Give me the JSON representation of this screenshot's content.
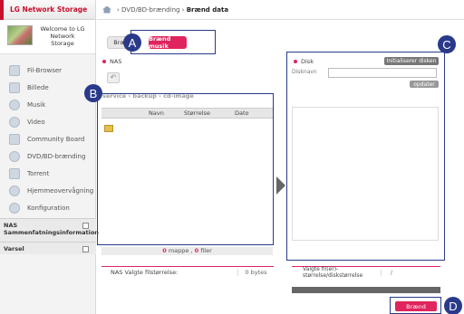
{
  "app": {
    "title": "LG Network Storage"
  },
  "welcome": {
    "text": "Welcome to LG Network Storage"
  },
  "sidebar": {
    "items": [
      {
        "label": "Fil-Browser",
        "icon": "file-browser-icon"
      },
      {
        "label": "Billede",
        "icon": "picture-icon"
      },
      {
        "label": "Musik",
        "icon": "music-icon"
      },
      {
        "label": "Video",
        "icon": "video-icon"
      },
      {
        "label": "Community Board",
        "icon": "community-icon"
      },
      {
        "label": "DVD/BD-brænding",
        "icon": "disc-icon"
      },
      {
        "label": "Torrent",
        "icon": "torrent-icon"
      },
      {
        "label": "Hjemmeovervågning",
        "icon": "camera-icon"
      },
      {
        "label": "Konfiguration",
        "icon": "gear-icon"
      }
    ],
    "section_nas": "NAS Sammenfatningsinformation",
    "section_varsel": "Varsel"
  },
  "breadcrumb": {
    "part1": "DVD/BD-brænding",
    "part2": "Brænd data"
  },
  "tabs": {
    "first": "Bræ",
    "active": "Brænd musik"
  },
  "callouts": {
    "a": "A",
    "b": "B",
    "c": "C",
    "d": "D"
  },
  "left_pane": {
    "source": "NAS",
    "path": "service › backup › cd-image",
    "columns": {
      "name": "Navn",
      "size": "Størrelse",
      "date": "Dato"
    },
    "count_folders": "0",
    "count_folders_label": "mappe ,",
    "count_files": "0",
    "count_files_label": "filer",
    "selected_size_label": "NAS Valgte filstørrelse:",
    "selected_size_value": "0 bytes"
  },
  "right_pane": {
    "disk_label": "Disk",
    "init_button": "Initialiserer disken",
    "disk_name_label": "Disknavn",
    "disk_name_value": "",
    "update_button": "opdater",
    "selected_size_label": "Valgte fil(er)-størrelse/diskstørrelse",
    "selected_size_value": "/"
  },
  "actions": {
    "burn": "Brænd"
  },
  "colors": {
    "accent": "#e0245e",
    "callout": "#2a3a8a",
    "brand_red": "#c8102e"
  }
}
